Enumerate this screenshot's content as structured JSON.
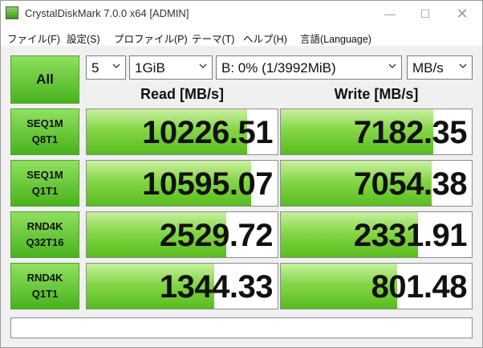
{
  "window": {
    "title": "CrystalDiskMark 7.0.0 x64 [ADMIN]"
  },
  "menu": [
    "ファイル(F)",
    "設定(S)",
    "プロファイル(P)",
    "テーマ(T)",
    "ヘルプ(H)",
    "言語(Language)"
  ],
  "controls": {
    "all_label": "All",
    "count": "5",
    "size": "1GiB",
    "drive": "B: 0% (1/3992MiB)",
    "unit": "MB/s"
  },
  "headers": {
    "read": "Read [MB/s]",
    "write": "Write [MB/s]"
  },
  "tests": [
    {
      "label_1": "SEQ1M",
      "label_2": "Q8T1",
      "read": "10226.51",
      "write": "7182.35",
      "read_fill": 0.84,
      "write_fill": 0.8
    },
    {
      "label_1": "SEQ1M",
      "label_2": "Q1T1",
      "read": "10595.07",
      "write": "7054.38",
      "read_fill": 0.86,
      "write_fill": 0.79
    },
    {
      "label_1": "RND4K",
      "label_2": "Q32T16",
      "read": "2529.72",
      "write": "2331.91",
      "read_fill": 0.73,
      "write_fill": 0.72
    },
    {
      "label_1": "RND4K",
      "label_2": "Q1T1",
      "read": "1344.33",
      "write": "801.48",
      "read_fill": 0.67,
      "write_fill": 0.61
    }
  ],
  "status": "",
  "colors": {
    "bar": "#58bc1e",
    "button": "#48b21c"
  }
}
